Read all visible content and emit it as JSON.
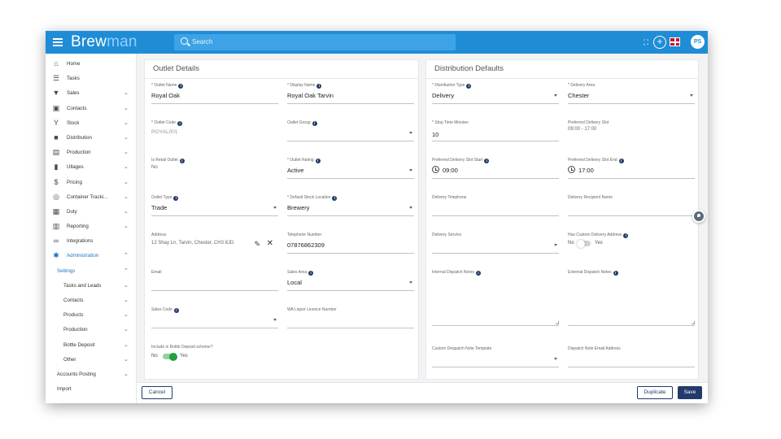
{
  "app": {
    "logo_part1": "Brew",
    "logo_part2": "man",
    "search_placeholder": "Search",
    "user_initials": "PS"
  },
  "sidebar": {
    "items": [
      {
        "label": "Home",
        "icon": "home-icon",
        "chevron": false
      },
      {
        "label": "Tasks",
        "icon": "list-icon",
        "chevron": false
      },
      {
        "label": "Sales",
        "icon": "basket-icon",
        "chevron": true
      },
      {
        "label": "Contacts",
        "icon": "contact-card-icon",
        "chevron": true
      },
      {
        "label": "Stock",
        "icon": "filter-icon",
        "chevron": true
      },
      {
        "label": "Distribution",
        "icon": "truck-icon",
        "chevron": true
      },
      {
        "label": "Production",
        "icon": "factory-icon",
        "chevron": true
      },
      {
        "label": "Ullages",
        "icon": "trash-icon",
        "chevron": true
      },
      {
        "label": "Pricing",
        "icon": "dollar-icon",
        "chevron": true
      },
      {
        "label": "Container Tracki...",
        "icon": "target-icon",
        "chevron": true
      },
      {
        "label": "Duty",
        "icon": "document-icon",
        "chevron": true
      },
      {
        "label": "Reporting",
        "icon": "report-icon",
        "chevron": true
      },
      {
        "label": "Integrations",
        "icon": "link-icon",
        "chevron": false
      },
      {
        "label": "Administration",
        "icon": "gear-icon",
        "chevron": true
      }
    ],
    "settings_label": "Settings",
    "sub_items": [
      {
        "label": "Tasks and Leads"
      },
      {
        "label": "Contacts"
      },
      {
        "label": "Products"
      },
      {
        "label": "Production"
      },
      {
        "label": "Bottle Deposit"
      },
      {
        "label": "Other"
      }
    ],
    "accounts_posting": "Accounts Posting",
    "import": "Import"
  },
  "outlet": {
    "title": "Outlet Details",
    "outlet_name_label": "* Outlet Name",
    "outlet_name": "Royal Oak",
    "display_name_label": "* Display Name",
    "display_name": "Royal Oak Tarvin",
    "outlet_code_label": "* Outlet Code",
    "outlet_code": "ROYAL001",
    "outlet_group_label": "Outlet Group",
    "outlet_group": "",
    "is_retail_label": "Is Retail Outlet",
    "is_retail": "No",
    "outlet_rating_label": "* Outlet Rating",
    "outlet_rating": "Active",
    "outlet_type_label": "Outlet Type",
    "outlet_type": "Trade",
    "stock_location_label": "* Default Stock Location",
    "stock_location": "Brewery",
    "address_label": "Address",
    "address": "12 Shay Ln, Tarvin, Chester, CH3 8JD",
    "telephone_label": "Telephone Number",
    "telephone": "07876862309",
    "email_label": "Email",
    "email": "",
    "sales_area_label": "Sales Area",
    "sales_area": "Local",
    "sales_code_label": "Sales Code",
    "sales_code": "",
    "wa_licence_label": "WA Liquor Licence Number",
    "wa_licence": "",
    "bottle_deposit_label": "Include in Bottle Deposit scheme?",
    "bottle_deposit_no": "No",
    "bottle_deposit_yes": "Yes"
  },
  "distribution": {
    "title": "Distribution Defaults",
    "dist_type_label": "* Distribution Type",
    "dist_type": "Delivery",
    "delivery_area_label": "* Delivery Area",
    "delivery_area": "Chester",
    "stop_time_label": "* Stop Time Minutes",
    "stop_time": "10",
    "pref_slot_label": "Preferred Delivery Slot",
    "pref_slot": "09:00 - 17:00",
    "slot_start_label": "Preferred Delivery Slot Start",
    "slot_start": "09:00",
    "slot_end_label": "Preferred Delivery Slot End",
    "slot_end": "17:00",
    "delivery_tel_label": "Delivery Telephone",
    "recipient_label": "Delivery Recipient Name",
    "delivery_service_label": "Delivery Service",
    "custom_address_label": "Has Custom Delivery Address",
    "custom_address_no": "No",
    "custom_address_yes": "Yes",
    "internal_notes_label": "Internal Dispatch Notes",
    "external_notes_label": "External Dispatch Notes",
    "custom_template_label": "Custom Despatch Note Template",
    "dispatch_email_label": "Dispatch Note Email Address"
  },
  "actions": {
    "cancel": "Cancel",
    "duplicate": "Duplicate",
    "save": "Save"
  },
  "colors": {
    "topbar": "#1f8dd6",
    "primary_dark": "#233a6c",
    "toggle_on": "#22a043"
  }
}
